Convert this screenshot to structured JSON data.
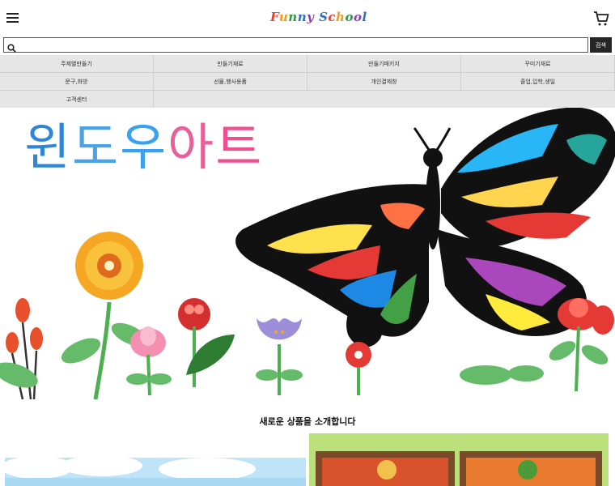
{
  "header": {
    "menu_icon": "hamburger-icon",
    "logo_text": "Funny School",
    "cart_icon": "cart-icon"
  },
  "search": {
    "value": "",
    "placeholder": "",
    "button_label": "검색"
  },
  "nav": {
    "items": [
      {
        "label": "주제별만들기"
      },
      {
        "label": "만들기재료"
      },
      {
        "label": "만들기패키지"
      },
      {
        "label": "꾸미기재료"
      },
      {
        "label": "문구,화방"
      },
      {
        "label": "선물,행사용품"
      },
      {
        "label": "개인결제창"
      },
      {
        "label": "졸업,입학,생일"
      },
      {
        "label": "고객센터"
      }
    ]
  },
  "banner": {
    "title": "윈도우아트"
  },
  "new_products": {
    "title": "새로운 상품을 소개합니다"
  },
  "colors": {
    "nav_bg": "#e6e6e6",
    "search_button_bg": "#262626"
  }
}
